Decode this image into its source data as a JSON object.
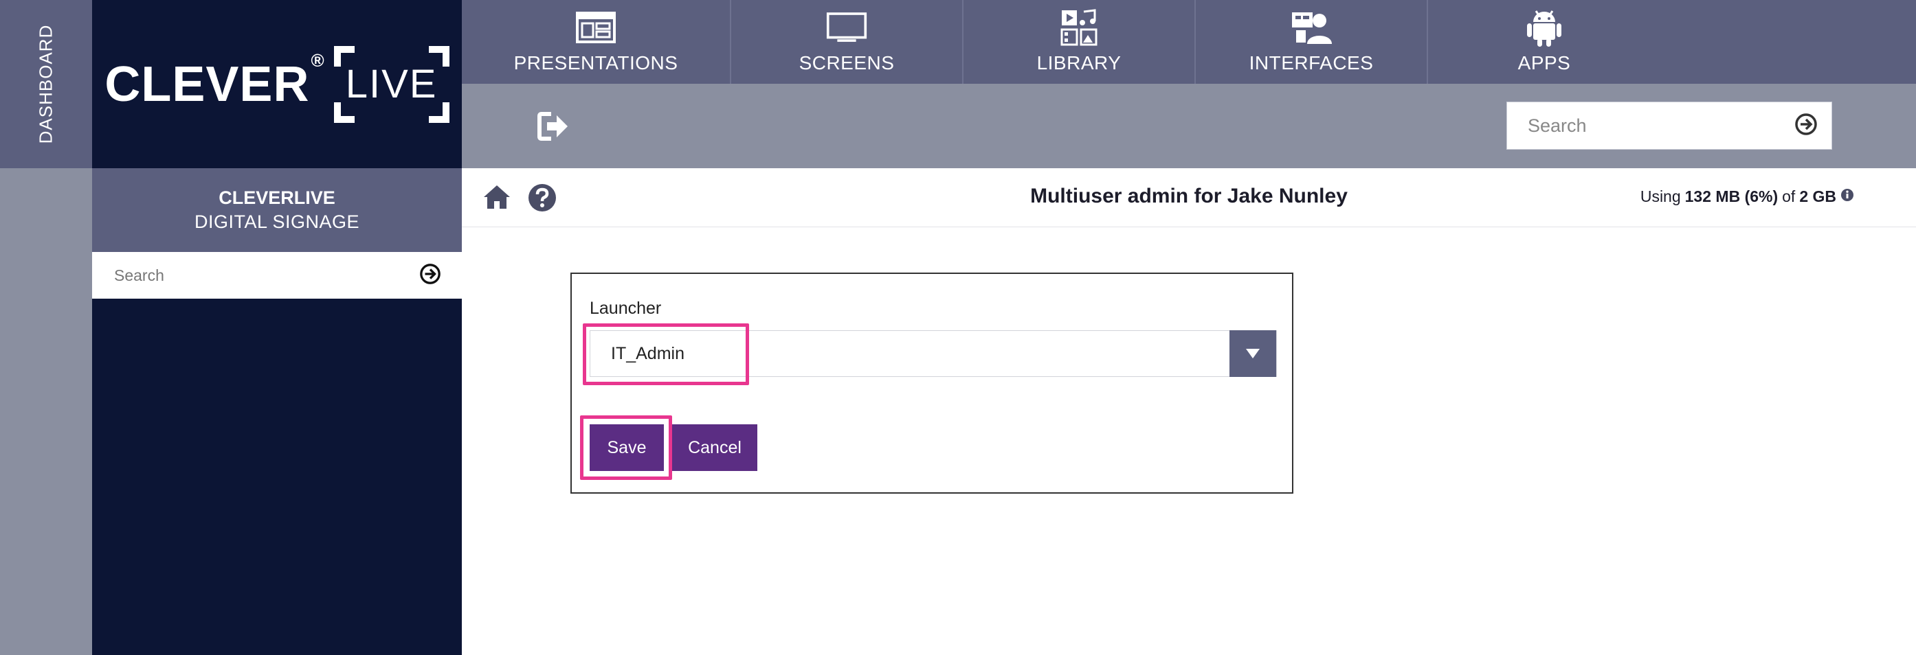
{
  "sidebar_strip": {
    "label": "DASHBOARD"
  },
  "logo": {
    "brand": "CLEVER",
    "reg": "®",
    "product": "LIVE"
  },
  "nav": {
    "items": [
      {
        "label": "PRESENTATIONS",
        "icon": "presentations-icon"
      },
      {
        "label": "SCREENS",
        "icon": "screens-icon"
      },
      {
        "label": "LIBRARY",
        "icon": "library-icon"
      },
      {
        "label": "INTERFACES",
        "icon": "interfaces-icon"
      },
      {
        "label": "APPS",
        "icon": "apps-icon"
      }
    ]
  },
  "toolbar": {
    "search_placeholder": "Search"
  },
  "left_panel": {
    "title_line1": "CLEVERLIVE",
    "title_line2": "DIGITAL SIGNAGE",
    "search_placeholder": "Search"
  },
  "page": {
    "title": "Multiuser admin for Jake Nunley",
    "usage_prefix": "Using",
    "usage_amount": "132 MB (6%)",
    "usage_of": "of",
    "usage_total": "2 GB"
  },
  "form": {
    "launcher_label": "Launcher",
    "launcher_value": "IT_Admin",
    "save_label": "Save",
    "cancel_label": "Cancel"
  },
  "colors": {
    "nav_bg": "#5b5f7e",
    "toolbar_bg": "#8a8fa0",
    "dark_navy": "#0c1535",
    "button_purple": "#5b2d83",
    "highlight_pink": "#e8368f"
  }
}
